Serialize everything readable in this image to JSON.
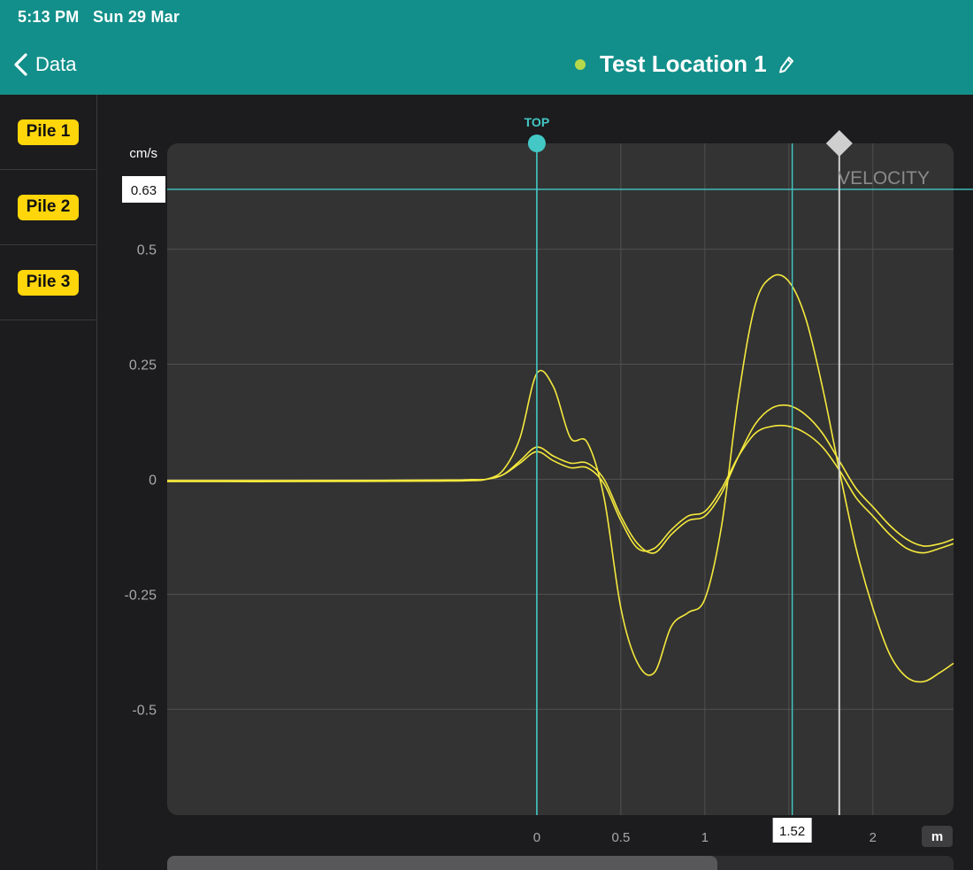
{
  "status_bar": {
    "time": "5:13 PM",
    "date": "Sun 29 Mar"
  },
  "nav": {
    "back_label": "Data",
    "title": "Test Location 1"
  },
  "sidebar": {
    "items": [
      {
        "label": "Pile 1"
      },
      {
        "label": "Pile 2"
      },
      {
        "label": "Pile 3"
      }
    ]
  },
  "colors": {
    "header": "#128f8a",
    "cursor": "#43c8c6",
    "series": "#f5e93d",
    "plot_bg": "#333333",
    "marker": "#cfcfcf"
  },
  "icons": {
    "back": "chevron-left-icon",
    "edit": "pencil-icon",
    "marker": "diamond-icon"
  },
  "chart_data": {
    "type": "line",
    "title": "VELOCITY",
    "ylabel": "cm/s",
    "xunit": "m",
    "xlim": [
      -2.2,
      2.48
    ],
    "ylim": [
      -0.73,
      0.73
    ],
    "xticks": [
      0,
      0.5,
      1,
      2
    ],
    "yticks": [
      0.5,
      0.25,
      0,
      -0.25,
      -0.5
    ],
    "ytick_labels": [
      "0.5",
      "0.25",
      "0",
      "-0.25",
      "-0.5"
    ],
    "xtick_labels": [
      "0",
      "0.5",
      "1",
      "2"
    ],
    "cursors": {
      "top": {
        "label": "TOP",
        "x": 0
      },
      "x_readout": {
        "value": "1.52",
        "x": 1.52
      },
      "y_readout": {
        "value": "0.63",
        "y": 0.63
      },
      "marker": {
        "x": 1.8
      }
    },
    "grid": true,
    "series": [
      {
        "x": [
          -2.2,
          -1.5,
          -0.6,
          -0.4,
          -0.3,
          -0.2,
          -0.1,
          0,
          0.1,
          0.2,
          0.3,
          0.4,
          0.5,
          0.6,
          0.7,
          0.8,
          0.9,
          1.0,
          1.1,
          1.2,
          1.3,
          1.4,
          1.5,
          1.6,
          1.7,
          1.8,
          1.9,
          2.0,
          2.1,
          2.2,
          2.3,
          2.4,
          2.48
        ],
        "y": [
          -0.005,
          -0.005,
          -0.004,
          -0.003,
          0.0,
          0.02,
          0.09,
          0.23,
          0.2,
          0.09,
          0.08,
          -0.04,
          -0.28,
          -0.4,
          -0.42,
          -0.32,
          -0.29,
          -0.26,
          -0.1,
          0.18,
          0.38,
          0.44,
          0.43,
          0.35,
          0.2,
          0.02,
          -0.15,
          -0.28,
          -0.38,
          -0.43,
          -0.44,
          -0.42,
          -0.4
        ]
      },
      {
        "x": [
          -2.2,
          -1.5,
          -0.6,
          -0.4,
          -0.3,
          -0.2,
          -0.1,
          0,
          0.1,
          0.2,
          0.3,
          0.4,
          0.5,
          0.6,
          0.7,
          0.8,
          0.9,
          1.0,
          1.1,
          1.2,
          1.3,
          1.4,
          1.5,
          1.6,
          1.7,
          1.8,
          1.9,
          2.0,
          2.1,
          2.2,
          2.3,
          2.4,
          2.48
        ],
        "y": [
          -0.003,
          -0.003,
          -0.002,
          -0.001,
          0.0,
          0.01,
          0.04,
          0.07,
          0.05,
          0.035,
          0.035,
          0.0,
          -0.08,
          -0.14,
          -0.16,
          -0.12,
          -0.09,
          -0.08,
          -0.03,
          0.05,
          0.12,
          0.155,
          0.16,
          0.14,
          0.1,
          0.04,
          -0.02,
          -0.06,
          -0.1,
          -0.13,
          -0.145,
          -0.14,
          -0.13
        ]
      },
      {
        "x": [
          -2.2,
          -1.5,
          -0.6,
          -0.4,
          -0.3,
          -0.2,
          -0.1,
          0,
          0.1,
          0.2,
          0.3,
          0.4,
          0.5,
          0.6,
          0.7,
          0.8,
          0.9,
          1.0,
          1.1,
          1.2,
          1.3,
          1.4,
          1.5,
          1.6,
          1.7,
          1.8,
          1.9,
          2.0,
          2.1,
          2.2,
          2.3,
          2.4,
          2.48
        ],
        "y": [
          -0.003,
          -0.003,
          -0.002,
          -0.001,
          0.0,
          0.01,
          0.035,
          0.06,
          0.04,
          0.025,
          0.025,
          -0.01,
          -0.09,
          -0.15,
          -0.15,
          -0.11,
          -0.08,
          -0.07,
          -0.02,
          0.05,
          0.1,
          0.115,
          0.115,
          0.1,
          0.07,
          0.02,
          -0.04,
          -0.08,
          -0.12,
          -0.15,
          -0.16,
          -0.15,
          -0.14
        ]
      }
    ]
  }
}
